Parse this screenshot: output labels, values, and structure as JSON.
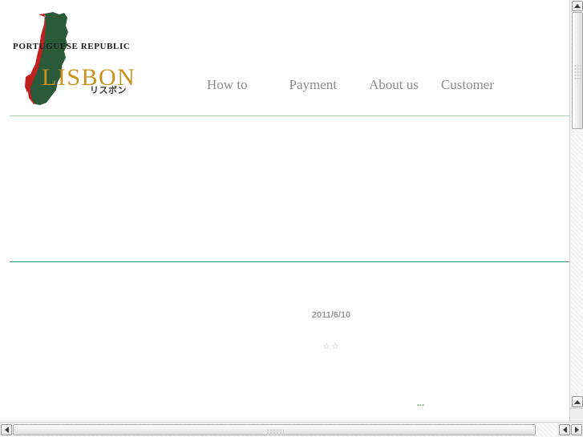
{
  "page": {
    "background_color": "#ffffff"
  },
  "logo": {
    "republic_text": "PORTUGUESE REPUBLIC",
    "city_text": "LISBON",
    "city_text_kana": "リスボン",
    "map_green": "#2a5a38",
    "map_red": "#c02020",
    "city_text_color": "#c8921e"
  },
  "nav": {
    "items": [
      {
        "label": "How to"
      },
      {
        "label": "Payment"
      },
      {
        "label": "About us"
      },
      {
        "label": "Customer"
      }
    ],
    "text_color": "#8d8d8d"
  },
  "rules": {
    "top_color": "#a9cdb7",
    "bottom_color": "#3a9a68"
  },
  "article": {
    "date": "2011/6/10",
    "rating": "☆☆",
    "footnote": "…"
  },
  "scrollbars": {
    "vertical": {
      "up_arrow": "▲",
      "down_arrow": "▼",
      "up_arrow_2": "▲"
    },
    "horizontal": {
      "left_arrow": "◀",
      "right_arrow": "▶",
      "left_arrow_2": "◀"
    }
  }
}
